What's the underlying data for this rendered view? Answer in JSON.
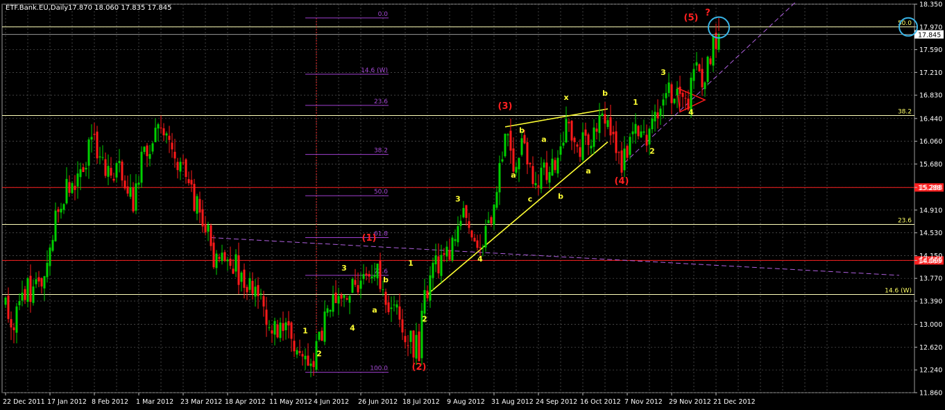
{
  "header": {
    "symbol": "ETF.Bank.EU,Daily",
    "ohlc": "17.870 18.060 17.835 17.845"
  },
  "colors": {
    "background": "#000000",
    "grid": "#5a5a5a",
    "bull": "#00d000",
    "bear": "#ff1a1a",
    "fib_grid": "#a040d0",
    "trend_yellow": "#ffff33",
    "hline_white": "#ffffbb",
    "hline_red": "#ff2020",
    "price_box_circle": "#39b4e6",
    "wave_red": "#ff2020",
    "wave_yellow": "#ffff33"
  },
  "chart_data": {
    "type": "candlestick",
    "y_axis": {
      "min": 11.86,
      "max": 18.35,
      "ticks": [
        "18.350",
        "17.970",
        "17.590",
        "17.210",
        "16.830",
        "16.440",
        "16.060",
        "15.680",
        "15.288",
        "14.910",
        "14.530",
        "14.150",
        "14.069",
        "13.770",
        "13.390",
        "13.000",
        "12.620",
        "12.240",
        "11.860"
      ],
      "tick_values": [
        18.35,
        17.97,
        17.59,
        17.21,
        16.83,
        16.44,
        16.06,
        15.68,
        15.288,
        14.91,
        14.53,
        14.15,
        14.069,
        13.77,
        13.39,
        13.0,
        12.62,
        12.24,
        11.86
      ]
    },
    "x_axis": {
      "labels": [
        "22 Dec 2011",
        "17 Jan 2012",
        "8 Feb 2012",
        "1 Mar 2012",
        "23 Mar 2012",
        "18 Apr 2012",
        "11 May 2012",
        "4 Jun 2012",
        "26 Jun 2012",
        "18 Jul 2012",
        "9 Aug 2012",
        "31 Aug 2012",
        "24 Sep 2012",
        "16 Oct 2012",
        "7 Nov 2012",
        "29 Nov 2012",
        "21 Dec 2012"
      ],
      "label_bar_index": [
        0,
        16,
        32,
        48,
        64,
        80,
        96,
        112,
        128,
        144,
        160,
        176,
        192,
        208,
        224,
        240,
        256
      ]
    },
    "current_price": 17.845,
    "horizontal_levels": [
      {
        "price": 17.97,
        "label": "50.0",
        "color": "#ffffbb"
      },
      {
        "price": 16.49,
        "label": "38.2",
        "color": "#ffffbb"
      },
      {
        "price": 15.288,
        "label": "15.288",
        "color": "#ff2020"
      },
      {
        "price": 14.67,
        "label": "23.6",
        "color": "#ffffbb"
      },
      {
        "price": 14.069,
        "label": "14.069",
        "color": "#ff2020"
      },
      {
        "price": 13.5,
        "label": "14.6 (W)",
        "color": "#ffffbb"
      }
    ],
    "fib_levels": [
      {
        "label": "0.0",
        "price": 18.12
      },
      {
        "label": "14.6 (W)",
        "price": 17.18
      },
      {
        "label": "23.6",
        "price": 16.66
      },
      {
        "label": "38.2",
        "price": 15.84
      },
      {
        "label": "50.0",
        "price": 15.15
      },
      {
        "label": "61.8",
        "price": 14.45
      },
      {
        "label": "72.6",
        "price": 13.82
      },
      {
        "label": "100.0",
        "price": 12.2
      }
    ],
    "wave_labels": [
      {
        "text": "(1)",
        "bar": 131,
        "price": 14.4,
        "color": "red"
      },
      {
        "text": "(2)",
        "bar": 149,
        "price": 12.24,
        "color": "red"
      },
      {
        "text": "(3)",
        "bar": 180,
        "price": 16.6,
        "color": "red"
      },
      {
        "text": "(4)",
        "bar": 222,
        "price": 15.35,
        "color": "red"
      },
      {
        "text": "(5)",
        "bar": 247,
        "price": 18.08,
        "color": "red"
      },
      {
        "text": "?",
        "bar": 253,
        "price": 18.16,
        "color": "red"
      },
      {
        "text": "1",
        "bar": 108,
        "price": 12.85,
        "color": "yellow"
      },
      {
        "text": "2",
        "bar": 113,
        "price": 12.47,
        "color": "yellow"
      },
      {
        "text": "3",
        "bar": 122,
        "price": 13.9,
        "color": "yellow"
      },
      {
        "text": "4",
        "bar": 125,
        "price": 12.9,
        "color": "yellow"
      },
      {
        "text": "a",
        "bar": 133,
        "price": 13.2,
        "color": "yellow"
      },
      {
        "text": "b",
        "bar": 137,
        "price": 13.7,
        "color": "yellow"
      },
      {
        "text": "1",
        "bar": 146,
        "price": 13.98,
        "color": "yellow"
      },
      {
        "text": "2",
        "bar": 151,
        "price": 13.05,
        "color": "yellow"
      },
      {
        "text": "3",
        "bar": 163,
        "price": 15.05,
        "color": "yellow"
      },
      {
        "text": "4",
        "bar": 171,
        "price": 14.05,
        "color": "yellow"
      },
      {
        "text": "a",
        "bar": 183,
        "price": 15.45,
        "color": "yellow"
      },
      {
        "text": "b",
        "bar": 186,
        "price": 16.2,
        "color": "yellow"
      },
      {
        "text": "c",
        "bar": 189,
        "price": 15.05,
        "color": "yellow"
      },
      {
        "text": "a",
        "bar": 194,
        "price": 16.05,
        "color": "yellow"
      },
      {
        "text": "b",
        "bar": 200,
        "price": 15.1,
        "color": "yellow"
      },
      {
        "text": "x",
        "bar": 202,
        "price": 16.75,
        "color": "yellow"
      },
      {
        "text": "a",
        "bar": 210,
        "price": 15.52,
        "color": "yellow"
      },
      {
        "text": "b",
        "bar": 216,
        "price": 16.82,
        "color": "yellow"
      },
      {
        "text": "1",
        "bar": 227,
        "price": 16.67,
        "color": "yellow"
      },
      {
        "text": "2",
        "bar": 233,
        "price": 15.85,
        "color": "yellow"
      },
      {
        "text": "3",
        "bar": 237,
        "price": 17.17,
        "color": "yellow"
      },
      {
        "text": "4",
        "bar": 247,
        "price": 16.5,
        "color": "yellow"
      }
    ],
    "trend_lines": [
      {
        "from": [
          152,
          13.5
        ],
        "to": [
          217,
          16.05
        ],
        "color": "yellow",
        "dash": false
      },
      {
        "from": [
          180,
          16.3
        ],
        "to": [
          217,
          16.6
        ],
        "color": "yellow",
        "dash": false
      },
      {
        "from": [
          74,
          14.45
        ],
        "to": [
          322,
          13.82
        ],
        "color": "purple",
        "dash": true
      },
      {
        "from": [
          223,
          15.7
        ],
        "to": [
          285,
          18.4
        ],
        "color": "purple",
        "dash": true
      }
    ],
    "candles_seed": 20121221
  }
}
